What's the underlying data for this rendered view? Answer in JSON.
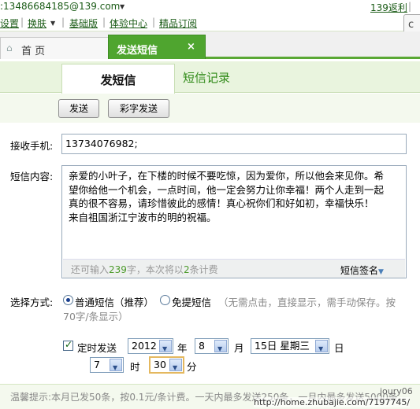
{
  "topbar": {
    "email": ":13486684185@139.com",
    "settings": "设置",
    "skin": "换肤",
    "basic": "基础版",
    "experience": "体验中心",
    "subscribe": "精品订阅",
    "rebate": "139返利"
  },
  "tabs": {
    "home": "首 页",
    "send_sms": "发送短信",
    "close": "×"
  },
  "subtabs": {
    "send": "发短信",
    "records": "短信记录"
  },
  "buttons": {
    "send": "发送",
    "mms": "彩字发送"
  },
  "form": {
    "phone_label": "接收手机:",
    "phone_value": "13734076982;",
    "content_label": "短信内容:",
    "content_lines": [
      "亲爱的小叶子，在下楼的时候不要吃惊，因为爱你，所以他会来见你。希",
      "望你给他一个机会，一点时间，他一定会努力让你幸福！两个人走到一起",
      "真的很不容易，请珍惜彼此的感情！真心祝你们和好如初，幸福快乐！",
      "来自祖国浙江宁波市的明的祝福。"
    ],
    "count_prefix": "还可输入",
    "count_remaining": "239",
    "count_mid": "字，本次将以",
    "count_parts": "2",
    "count_suffix": "条计费",
    "signature": "短信签名",
    "mode_label": "选择方式:",
    "mode_normal": "普通短信（推荐）",
    "mode_flash": "免提短信",
    "mode_flash_note_1": "（无需点击，直接显示，需手动保存。按",
    "mode_flash_note_2": "70字/条显示）",
    "scheduled_label": "定时发送",
    "year": "2012",
    "year_unit": "年",
    "month": "8",
    "month_unit": "月",
    "day": "15日 星期三",
    "day_unit": "日",
    "hour": "7",
    "hour_unit": "时",
    "minute": "30",
    "minute_unit": "分"
  },
  "tip": "温馨提示:本月已发50条，按0.1元/条计费。一天内最多发送250条，一月内最多发送5000条。",
  "watermark": {
    "user": "joury06",
    "url": "http://home.zhubajie.com/7197745/"
  }
}
